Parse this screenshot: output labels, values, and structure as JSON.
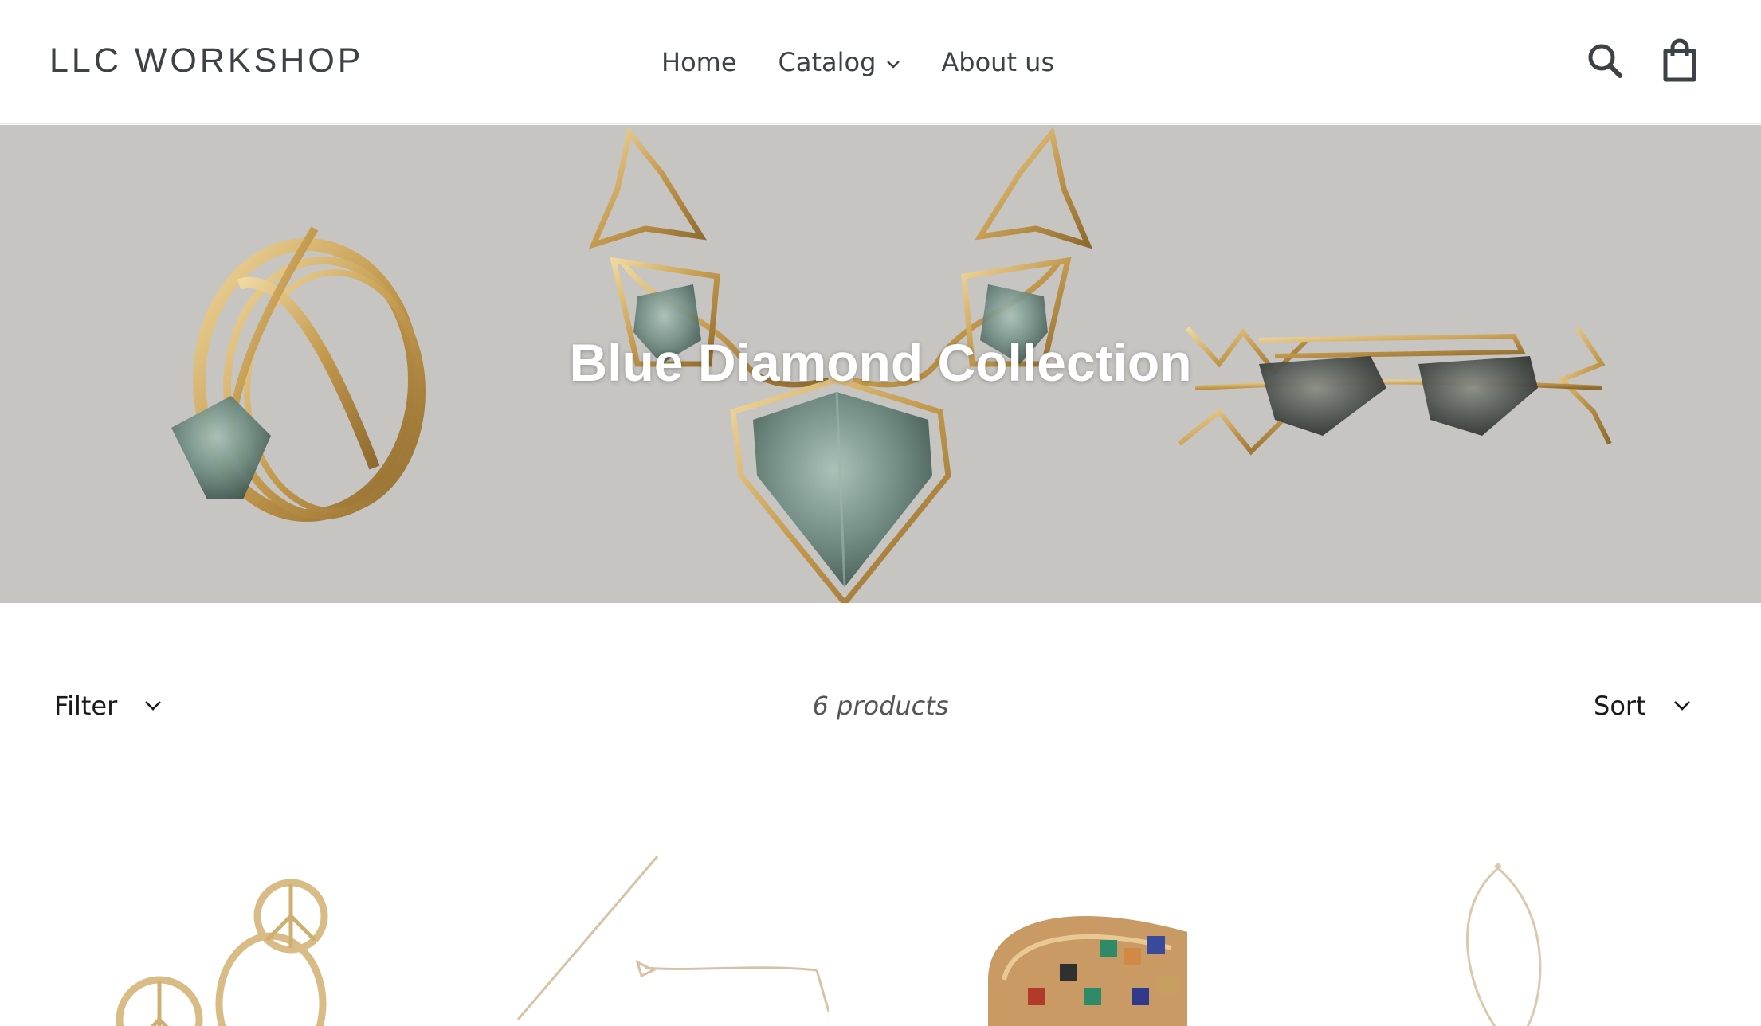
{
  "header": {
    "logo": "LLC WORKSHOP",
    "nav": {
      "home": "Home",
      "catalog": "Catalog",
      "about": "About us"
    },
    "icons": [
      "search-icon",
      "cart-icon"
    ]
  },
  "hero": {
    "title": "Blue Diamond Collection"
  },
  "toolbar": {
    "filter_label": "Filter",
    "product_count": "6 products",
    "sort_label": "Sort"
  },
  "products": [
    {
      "image": "peace-sign-earrings"
    },
    {
      "image": "gold-chain-necklace"
    },
    {
      "image": "enamel-checkered-ring"
    },
    {
      "image": "fine-pendant-necklace"
    }
  ],
  "colors": {
    "text": "#3d4246",
    "hero_bg": "#c6c5c1",
    "gold": "#c9a45a",
    "gem": "#6f8b82"
  }
}
